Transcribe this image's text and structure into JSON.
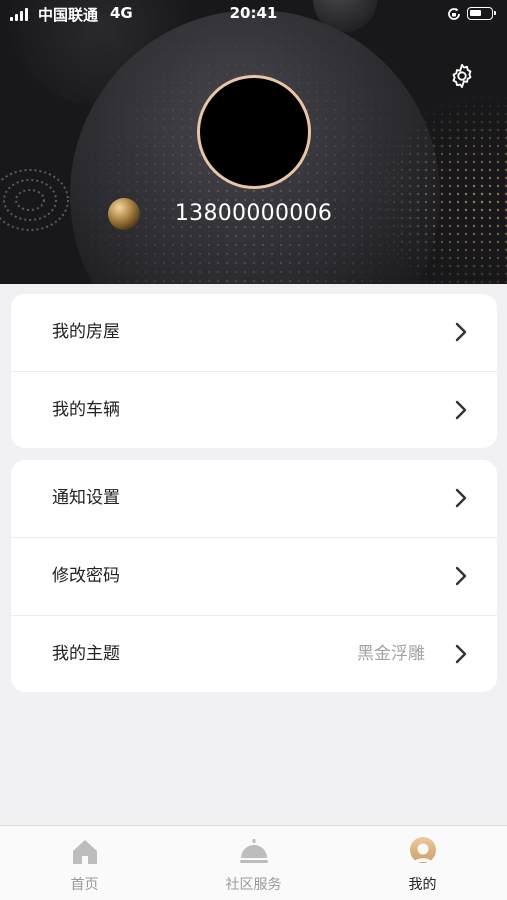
{
  "status_bar": {
    "carrier": "中国联通",
    "network": "4G",
    "time": "20:41"
  },
  "profile": {
    "phone": "13800000006",
    "settings_icon": "gear-icon"
  },
  "menu_groups": [
    {
      "items": [
        {
          "label": "我的房屋",
          "value": ""
        },
        {
          "label": "我的车辆",
          "value": ""
        }
      ]
    },
    {
      "items": [
        {
          "label": "通知设置",
          "value": ""
        },
        {
          "label": "修改密码",
          "value": ""
        },
        {
          "label": "我的主题",
          "value": "黑金浮雕"
        }
      ]
    }
  ],
  "tabbar": {
    "items": [
      {
        "label": "首页",
        "icon": "home-icon",
        "active": false
      },
      {
        "label": "社区服务",
        "icon": "service-bell-icon",
        "active": false
      },
      {
        "label": "我的",
        "icon": "profile-icon",
        "active": true
      }
    ]
  },
  "colors": {
    "avatar_ring": "#e9c5a6",
    "header_bg": "#18181b",
    "page_bg": "#f1f1f3",
    "accent_gold": "#c9a06a"
  }
}
